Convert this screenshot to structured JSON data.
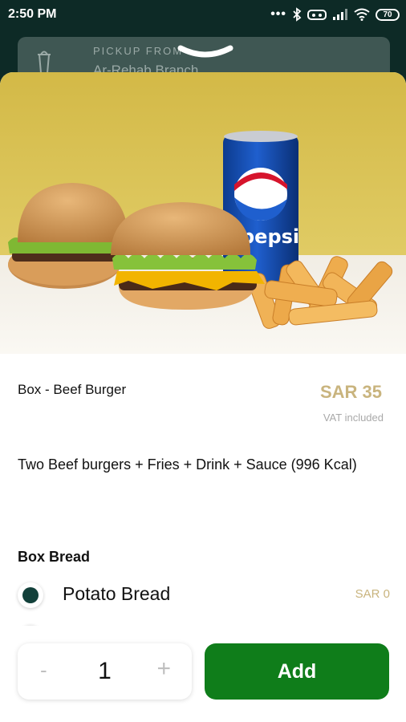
{
  "status_bar": {
    "time": "2:50 PM",
    "dots": "•••",
    "battery": "70"
  },
  "pickup": {
    "label": "PICKUP FROM",
    "branch": "Ar-Rehab Branch"
  },
  "product": {
    "name": "Box - Beef Burger",
    "price": "SAR 35",
    "vat_note": "VAT included",
    "description": "Two Beef burgers + Fries + Drink + Sauce (996 Kcal)",
    "can_text": "pepsi"
  },
  "options": {
    "section_title": "Box Bread",
    "items": [
      {
        "label": "Potato Bread",
        "price": "SAR 0",
        "selected": true
      }
    ]
  },
  "cart": {
    "quantity": "1",
    "minus_label": "-",
    "plus_label": "+",
    "add_label": "Add"
  },
  "colors": {
    "brand_green": "#0f7d1a",
    "radio_selected": "#12403a",
    "price_gold": "#c9b47e",
    "dark_bg": "#0d2a26"
  },
  "icons": [
    "bluetooth-icon",
    "vr-icon",
    "signal-icon",
    "wifi-icon",
    "battery-icon",
    "drink-cup-icon",
    "chevron-down-icon"
  ]
}
